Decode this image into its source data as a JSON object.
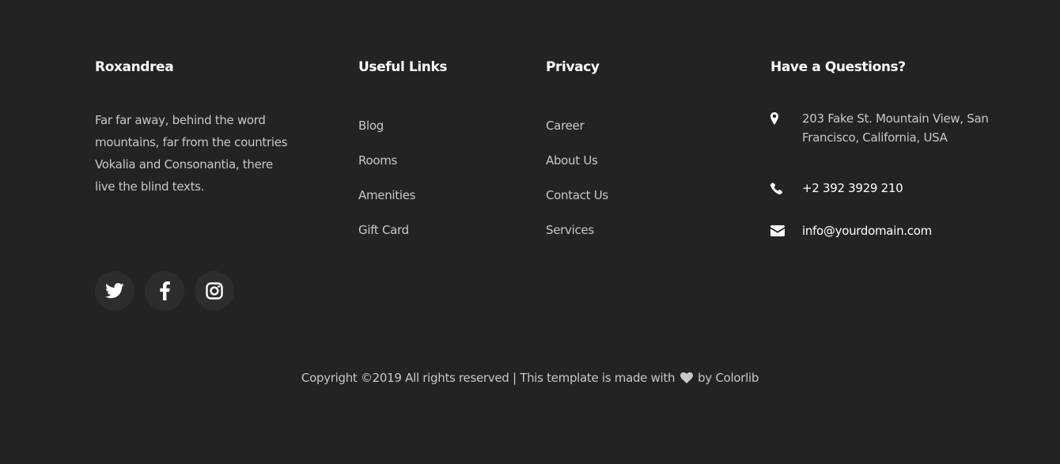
{
  "about": {
    "title": "Roxandrea",
    "text": "Far far away, behind the word mountains, far from the countries Vokalia and Consonantia, there live the blind texts."
  },
  "social": [
    {
      "icon": "twitter-icon"
    },
    {
      "icon": "facebook-icon"
    },
    {
      "icon": "instagram-icon"
    }
  ],
  "useful_links": {
    "title": "Useful Links",
    "items": [
      "Blog",
      "Rooms",
      "Amenities",
      "Gift Card"
    ]
  },
  "privacy": {
    "title": "Privacy",
    "items": [
      "Career",
      "About Us",
      "Contact Us",
      "Services"
    ]
  },
  "contact": {
    "title": "Have a Questions?",
    "address": "203 Fake St. Mountain View, San Francisco, California, USA",
    "phone": "+2 392 3929 210",
    "email": "info@yourdomain.com"
  },
  "copyright": {
    "prefix": "Copyright ©2019 All rights reserved | This template is made with",
    "by": "by",
    "link": "Colorlib"
  },
  "colors": {
    "background": "#232323",
    "heading": "#ffffff",
    "text": "#c8c8c8",
    "social_bg": "#2d2d2d"
  }
}
